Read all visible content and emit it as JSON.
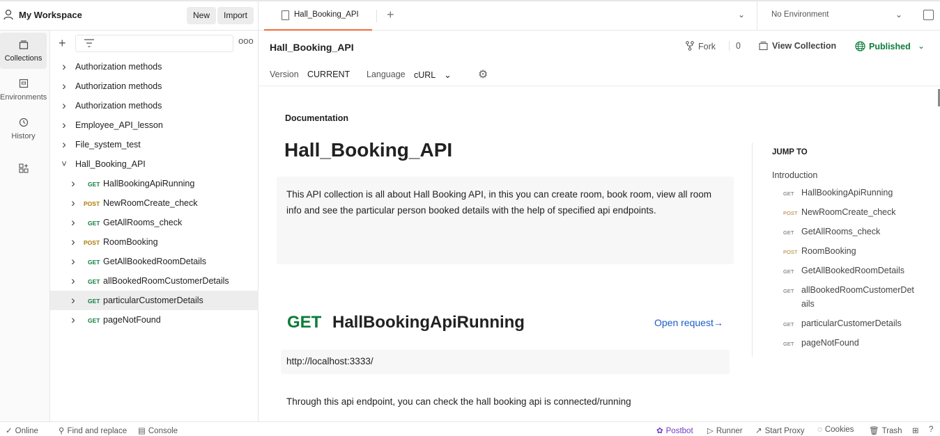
{
  "workspace": {
    "title": "My Workspace",
    "new_label": "New",
    "import_label": "Import"
  },
  "rail": {
    "items": [
      {
        "label": "Collections",
        "icon": "collections-icon"
      },
      {
        "label": "Environments",
        "icon": "environments-icon"
      },
      {
        "label": "History",
        "icon": "history-icon"
      },
      {
        "label": "",
        "icon": "apps-icon"
      }
    ]
  },
  "sidebar": {
    "tree": [
      {
        "label": "Authorization methods",
        "method": "",
        "depth": 0,
        "expanded": false
      },
      {
        "label": "Authorization methods",
        "method": "",
        "depth": 0,
        "expanded": false
      },
      {
        "label": "Authorization methods",
        "method": "",
        "depth": 0,
        "expanded": false
      },
      {
        "label": "Employee_API_lesson",
        "method": "",
        "depth": 0,
        "expanded": false
      },
      {
        "label": "File_system_test",
        "method": "",
        "depth": 0,
        "expanded": false
      },
      {
        "label": "Hall_Booking_API",
        "method": "",
        "depth": 0,
        "expanded": true
      },
      {
        "label": "HallBookingApiRunning",
        "method": "GET",
        "depth": 1,
        "expanded": false
      },
      {
        "label": "NewRoomCreate_check",
        "method": "POST",
        "depth": 1,
        "expanded": false
      },
      {
        "label": "GetAllRooms_check",
        "method": "GET",
        "depth": 1,
        "expanded": false
      },
      {
        "label": "RoomBooking",
        "method": "POST",
        "depth": 1,
        "expanded": false
      },
      {
        "label": "GetAllBookedRoomDetails",
        "method": "GET",
        "depth": 1,
        "expanded": false
      },
      {
        "label": "allBookedRoomCustomerDetails",
        "method": "GET",
        "depth": 1,
        "expanded": false
      },
      {
        "label": "particularCustomerDetails",
        "method": "GET",
        "depth": 1,
        "expanded": false,
        "selected": true
      },
      {
        "label": "pageNotFound",
        "method": "GET",
        "depth": 1,
        "expanded": false
      }
    ]
  },
  "tabs": {
    "active_label": "Hall_Booking_API",
    "environment": "No Environment"
  },
  "collection": {
    "title": "Hall_Booking_API",
    "fork_label": "Fork",
    "fork_count": "0",
    "view_collection": "View Collection",
    "published": "Published",
    "version_label": "Version",
    "version_value": "CURRENT",
    "language_label": "Language",
    "language_value": "cURL"
  },
  "doc": {
    "section_label": "Documentation",
    "heading": "Hall_Booking_API",
    "description": "This API collection is all about Hall Booking API, in this you can create room, book room, view all room info and see the particular person booked details with the help of specified api endpoints.",
    "request": {
      "method": "GET",
      "name": "HallBookingApiRunning",
      "open_label": "Open request→",
      "url": "http://localhost:3333/",
      "description": "Through this api endpoint, you can check the hall booking api is connected/running"
    }
  },
  "jump_to": {
    "title": "JUMP TO",
    "intro": "Introduction",
    "items": [
      {
        "method": "GET",
        "label": "HallBookingApiRunning"
      },
      {
        "method": "POST",
        "label": "NewRoomCreate_check"
      },
      {
        "method": "GET",
        "label": "GetAllRooms_check"
      },
      {
        "method": "POST",
        "label": "RoomBooking"
      },
      {
        "method": "GET",
        "label": "GetAllBookedRoomDetails"
      },
      {
        "method": "GET",
        "label": "allBookedRoomCustomerDetails"
      },
      {
        "method": "GET",
        "label": "particularCustomerDetails"
      },
      {
        "method": "GET",
        "label": "pageNotFound"
      }
    ]
  },
  "statusbar": {
    "online": "Online",
    "find_replace": "Find and replace",
    "console": "Console",
    "postbot": "Postbot",
    "runner": "Runner",
    "start_proxy": "Start Proxy",
    "cookies": "Cookies",
    "trash": "Trash"
  }
}
